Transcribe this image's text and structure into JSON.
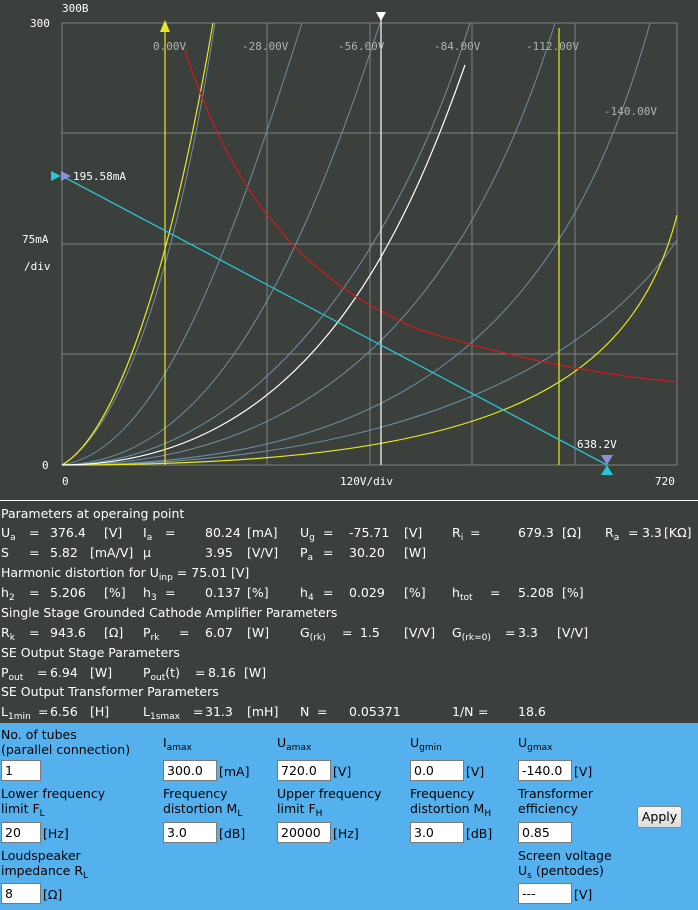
{
  "graph": {
    "tube_name": "300B",
    "y_axis": {
      "max_label": "300",
      "div_label": "75mA",
      "div_unit": "/div",
      "zero_label": "0"
    },
    "x_axis": {
      "zero_label": "0",
      "div_label": "120V/div",
      "max_label": "720"
    },
    "grid_voltages": [
      "0.00V",
      "-28.00V",
      "-56.00V",
      "-84.00V",
      "-112.00V",
      "-140.00V"
    ],
    "load_current_label": "195.58mA",
    "load_voltage_label": "638.2V",
    "colors": {
      "background": "#3b403c",
      "grid": "#7e827e",
      "curves": "#6e8fa6",
      "limit": "#e8e822",
      "power": "#c81e1e",
      "load": "#2bc3d6",
      "operating": "#ffffff"
    }
  },
  "params": {
    "op_title": "Parameters at operaing point",
    "ua": {
      "sym": "U",
      "sub": "a",
      "eq": "=",
      "val": "376.4",
      "unit": "[V]"
    },
    "ia": {
      "sym": "I",
      "sub": "a",
      "eq": "=",
      "val": "80.24",
      "unit": "[mA]"
    },
    "ug": {
      "sym": "U",
      "sub": "g",
      "eq": "=",
      "val": "-75.71",
      "unit": "[V]"
    },
    "ri": {
      "sym": "R",
      "sub": "i",
      "eq": "=",
      "val": "679.3",
      "unit": "[Ω]"
    },
    "ra": {
      "sym": "R",
      "sub": "a",
      "eq": "=",
      "val": "3.3",
      "unit": "[KΩ]"
    },
    "s": {
      "sym": "S",
      "eq": "=",
      "val": "5.82",
      "unit": "[mA/V]"
    },
    "mu": {
      "sym": "μ",
      "val": "3.95",
      "unit": "[V/V]"
    },
    "pa": {
      "sym": "P",
      "sub": "a",
      "eq": "=",
      "val": "30.20",
      "unit": "[W]"
    },
    "hd_title": "Harmonic distortion for U",
    "hd_title_sub": "inp",
    "hd_title_rest": "= 75.01 [V]",
    "h2": {
      "sym": "h",
      "sub": "2",
      "eq": "=",
      "val": "5.206",
      "unit": "[%]"
    },
    "h3": {
      "sym": "h",
      "sub": "3",
      "eq": "=",
      "val": "0.137",
      "unit": "[%]"
    },
    "h4": {
      "sym": "h",
      "sub": "4",
      "eq": "=",
      "val": "0.029",
      "unit": "[%]"
    },
    "htot": {
      "sym": "h",
      "sub": "tot",
      "eq": "=",
      "val": "5.208",
      "unit": "[%]"
    },
    "sgc_title": "Single Stage Grounded Cathode Amplifier Parameters",
    "rk": {
      "sym": "R",
      "sub": "k",
      "eq": "=",
      "val": "943.6",
      "unit": "[Ω]"
    },
    "prk": {
      "sym": "P",
      "sub": "rk",
      "eq": "=",
      "val": "6.07",
      "unit": "[W]"
    },
    "grk": {
      "sym": "G",
      "sub": "(rk)",
      "eq": "=",
      "val": "1.5",
      "unit": "[V/V]"
    },
    "grk0": {
      "sym": "G",
      "sub": "(rk=0)",
      "eq": "=",
      "val": "3.3",
      "unit": "[V/V]"
    },
    "se_title": "SE Output Stage Parameters",
    "pout": {
      "sym": "P",
      "sub": "out",
      "eq": "=",
      "val": "6.94",
      "unit": "[W]"
    },
    "poutt": {
      "sym": "P",
      "sub": "out",
      "sym_rest": "(t)",
      "eq": "=",
      "val": "8.16",
      "unit": "[W]"
    },
    "tr_title": "SE Output Transformer Parameters",
    "l1min": {
      "sym": "L",
      "sub": "1min",
      "eq": "=",
      "val": "6.56",
      "unit": "[H]"
    },
    "l1smax": {
      "sym": "L",
      "sub": "1smax",
      "eq": "=",
      "val": "31.3",
      "unit": "[mH]"
    },
    "n": {
      "sym": "N",
      "eq": "=",
      "val": "0.05371"
    },
    "inv_n": {
      "sym": "1/N",
      "eq": "=",
      "val": "18.6"
    }
  },
  "controls": {
    "tubes": {
      "label1": "No. of tubes",
      "label2": "(parallel connection)",
      "value": "1"
    },
    "iamax": {
      "sym": "I",
      "sub": "amax",
      "value": "300.0",
      "unit": "[mA]"
    },
    "uamax": {
      "sym": "U",
      "sub": "amax",
      "value": "720.0",
      "unit": "[V]"
    },
    "ugmin": {
      "sym": "U",
      "sub": "gmin",
      "value": "0.0",
      "unit": "[V]"
    },
    "ugmax": {
      "sym": "U",
      "sub": "gmax",
      "value": "-140.0",
      "unit": "[V]"
    },
    "fl": {
      "label1": "Lower frequency",
      "label2": "limit F",
      "sub": "L",
      "value": "20",
      "unit": "[Hz]"
    },
    "ml": {
      "label1": "Frequency",
      "label2": "distortion M",
      "sub": "L",
      "value": "3.0",
      "unit": "[dB]"
    },
    "fh": {
      "label1": "Upper frequency",
      "label2": "limit F",
      "sub": "H",
      "value": "20000",
      "unit": "[Hz]"
    },
    "mh": {
      "label1": "Frequency",
      "label2": "distortion M",
      "sub": "H",
      "value": "3.0",
      "unit": "[dB]"
    },
    "eff": {
      "label1": "Transformer",
      "label2": "efficiency",
      "value": "0.85"
    },
    "apply_label": "Apply",
    "rl": {
      "label1": "Loudspeaker",
      "label2": "impedance R",
      "sub": "L",
      "value": "8",
      "unit": "[Ω]"
    },
    "us": {
      "label1": "Screen voltage",
      "label2": "U",
      "sub": "s",
      "label2_rest": "(pentodes)",
      "value": "---",
      "unit": "[V]"
    }
  }
}
